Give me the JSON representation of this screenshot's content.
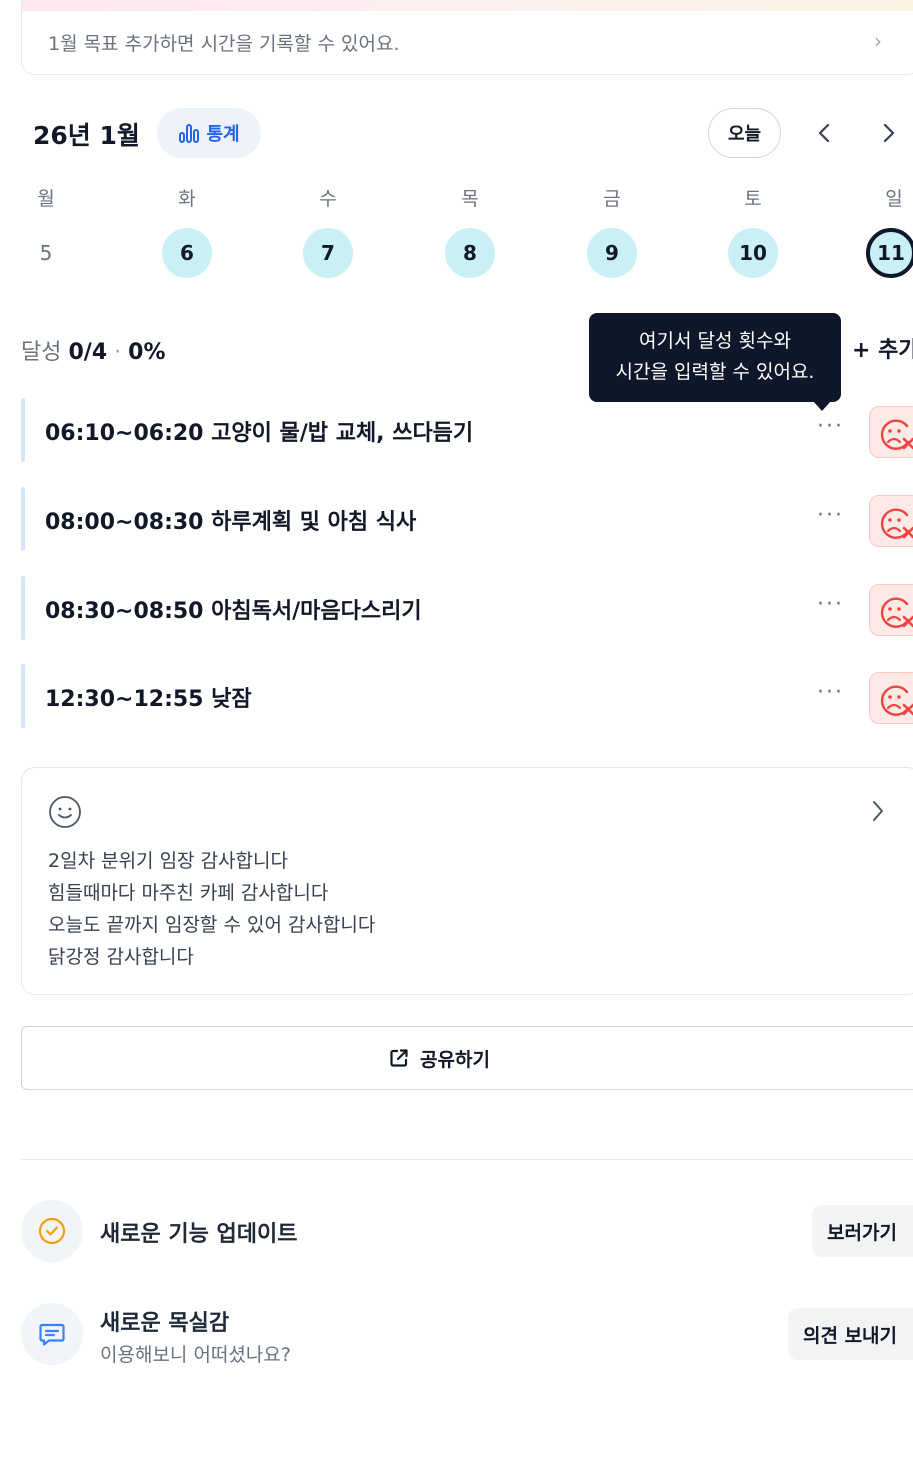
{
  "goal_banner": {
    "text": "1월 목표  추가하면 시간을 기록할 수 있어요."
  },
  "calendar": {
    "month_title": "26년 1월",
    "stats_label": "통계",
    "today_label": "오늘",
    "weekdays": [
      "월",
      "화",
      "수",
      "목",
      "금",
      "토",
      "일"
    ],
    "days": [
      "5",
      "6",
      "7",
      "8",
      "9",
      "10",
      "11"
    ],
    "selected_day": "11"
  },
  "achievement": {
    "label": "달성",
    "count": "0/4",
    "separator": "·",
    "percent": "0%",
    "add_label": "+ 추가"
  },
  "tooltip": {
    "line1": "여기서 달성 횟수와",
    "line2": "시간을 입력할 수 있어요."
  },
  "tasks": [
    {
      "label": "06:10~06:20 고양이 물/밥 교체, 쓰다듬기",
      "more": "···"
    },
    {
      "label": "08:00~08:30 하루계획 및 아침 식사",
      "more": "···"
    },
    {
      "label": "08:30~08:50 아침독서/마음다스리기",
      "more": "···"
    },
    {
      "label": "12:30~12:55 낮잠",
      "more": "···"
    }
  ],
  "gratitude": {
    "lines": [
      "2일차 분위기 임장 감사합니다",
      "힘들때마다 마주친 카페 감사합니다",
      "오늘도 끝까지 임장할 수 있어 감사합니다",
      "닭강정 감사합니다"
    ]
  },
  "share": {
    "label": "공유하기"
  },
  "updates": {
    "title": "새로운 기능 업데이트",
    "button": "보러가기"
  },
  "feedback": {
    "title": "새로운 목실감",
    "subtitle": "이용해보니 어떠셨나요?",
    "button": "의견 보내기"
  },
  "colors": {
    "accent_blue": "#2563eb",
    "day_done": "#c9f0f4",
    "fail_bg": "#fde9e6",
    "fail_icon": "#ef4444",
    "check_orange": "#f59e0b",
    "feedback_blue": "#3b82f6"
  }
}
